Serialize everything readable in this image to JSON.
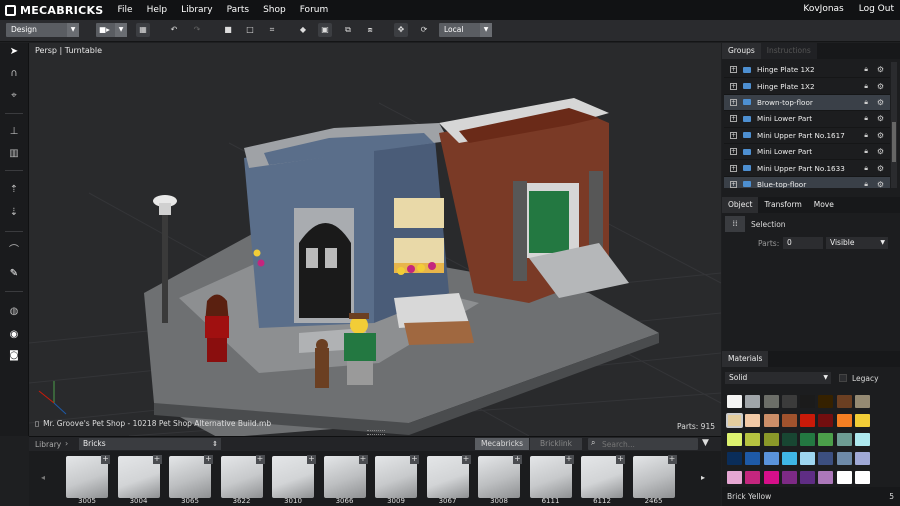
{
  "app": {
    "name": "MECABRICKS"
  },
  "menu": [
    "File",
    "Help",
    "Library",
    "Parts",
    "Shop",
    "Forum"
  ],
  "user": {
    "name": "KovJonas",
    "logout": "Log Out"
  },
  "toolbar": {
    "mode": "Design",
    "space": "Local"
  },
  "viewport": {
    "label": "Persp | Turntable",
    "filename": "Mr. Groove's Pet Shop - 10218 Pet Shop Alternative Build.mb",
    "parts_count": "Parts: 915"
  },
  "panel": {
    "tabs": [
      "Groups",
      "Instructions"
    ],
    "groups": [
      {
        "name": "Hinge Plate 1X2",
        "selected": false
      },
      {
        "name": "Hinge Plate 1X2",
        "selected": false
      },
      {
        "name": "Brown-top-floor",
        "selected": true
      },
      {
        "name": "Mini Lower Part",
        "selected": false
      },
      {
        "name": "Mini Upper Part No.1617",
        "selected": false
      },
      {
        "name": "Mini Lower Part",
        "selected": false
      },
      {
        "name": "Mini Upper Part No.1633",
        "selected": false
      },
      {
        "name": "Blue-top-floor",
        "selected": true
      }
    ],
    "prop_tabs": [
      "Object",
      "Transform",
      "Move"
    ],
    "selection_label": "Selection",
    "parts_label": "Parts:",
    "parts_value": "0",
    "visibility": "Visible",
    "materials_tab": "Materials",
    "material_type": "Solid",
    "legacy_label": "Legacy",
    "selected_color_name": "Brick Yellow",
    "selected_color_id": "5",
    "swatch_colors": [
      "#f4f4f4",
      "#a0a5a9",
      "#6c6e68",
      "#3b3b3b",
      "#1b1b1b",
      "#352100",
      "#6b3f22",
      "#958a73",
      "#e4cd9e",
      "#f2c9a6",
      "#cc8e68",
      "#a0522d",
      "#c91a09",
      "#720e0f",
      "#f57f23",
      "#f2cd37",
      "#ddf26f",
      "#b6c340",
      "#8a9829",
      "#184632",
      "#237841",
      "#4b9f4a",
      "#6e9d94",
      "#aee9ef",
      "#0a2d5a",
      "#1e5aa8",
      "#5a93db",
      "#3fb6e6",
      "#9ed6f0",
      "#3c4f80",
      "#6e8aa8",
      "#a0a9d6",
      "#e6a7d3",
      "#c4267e",
      "#d60f8a",
      "#7d2a85",
      "#5f2d84",
      "#ac78ba",
      "#ffffff",
      "#ffffff"
    ],
    "selected_swatch_index": 8
  },
  "library": {
    "label": "Library",
    "category": "Bricks",
    "source_tabs": [
      "Mecabricks",
      "Bricklink"
    ],
    "search_placeholder": "Search..."
  },
  "parts": [
    "3005",
    "3004",
    "3065",
    "3622",
    "3010",
    "3066",
    "3009",
    "3067",
    "3008",
    "6111",
    "6112",
    "2465"
  ]
}
